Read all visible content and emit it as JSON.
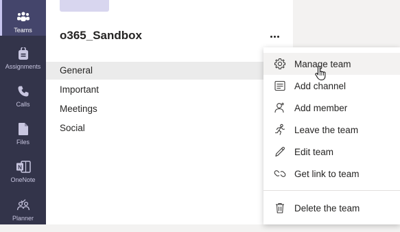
{
  "rail": {
    "items": [
      {
        "label": "Teams",
        "icon": "teams-icon",
        "active": true
      },
      {
        "label": "Assignments",
        "icon": "assignments-icon"
      },
      {
        "label": "Calls",
        "icon": "calls-icon"
      },
      {
        "label": "Files",
        "icon": "files-icon"
      },
      {
        "label": "OneNote",
        "icon": "onenote-icon"
      },
      {
        "label": "Planner",
        "icon": "planner-icon"
      }
    ]
  },
  "team": {
    "name": "o365_Sandbox",
    "more_icon": "more-options-icon",
    "channels": [
      {
        "label": "General",
        "selected": true
      },
      {
        "label": "Important"
      },
      {
        "label": "Meetings"
      },
      {
        "label": "Social"
      }
    ]
  },
  "context_menu": {
    "items": [
      {
        "label": "Manage team",
        "icon": "gear-icon",
        "hovered": true
      },
      {
        "label": "Add channel",
        "icon": "add-channel-icon"
      },
      {
        "label": "Add member",
        "icon": "add-member-icon"
      },
      {
        "label": "Leave the team",
        "icon": "leave-icon"
      },
      {
        "label": "Edit team",
        "icon": "pencil-icon"
      },
      {
        "label": "Get link to team",
        "icon": "link-icon"
      },
      {
        "label": "Delete the team",
        "icon": "trash-icon"
      }
    ]
  },
  "colors": {
    "rail_bg": "#33344a",
    "rail_active": "#44456b",
    "accent": "#c8c6f0",
    "text": "#252423"
  }
}
